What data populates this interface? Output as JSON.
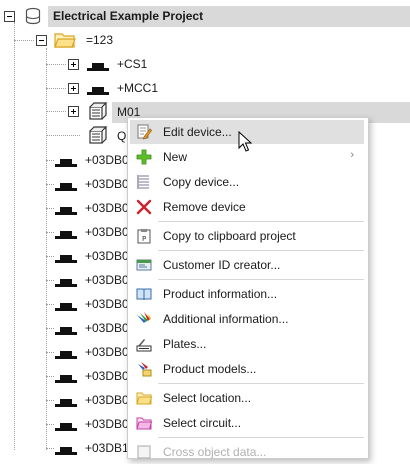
{
  "tree": {
    "root": {
      "label": "Electrical Example Project",
      "icon": "database-icon"
    },
    "group": {
      "label": "=123",
      "icon": "folder-icon"
    },
    "children": [
      {
        "label": "+CS1",
        "icon": "cabinet-icon"
      },
      {
        "label": "+MCC1",
        "icon": "cabinet-icon"
      },
      {
        "label": "M01",
        "icon": "device-icon"
      },
      {
        "label": "Q",
        "icon": "device-icon"
      }
    ],
    "siblings": [
      "+03DB0",
      "+03DB0",
      "+03DB0",
      "+03DB0",
      "+03DB0",
      "+03DB0",
      "+03DB0",
      "+03DB0",
      "+03DB0",
      "+03DB0",
      "+03DB0",
      "+03DB0",
      "+03DB1"
    ]
  },
  "context_menu": {
    "items": [
      {
        "label": "Edit device...",
        "icon": "edit-document-icon",
        "hover": true
      },
      {
        "label": "New",
        "icon": "green-plus-icon",
        "submenu": true
      },
      {
        "label": "Copy device...",
        "icon": "copy-list-icon"
      },
      {
        "label": "Remove device",
        "icon": "red-x-icon"
      },
      {
        "label": "Copy to clipboard project",
        "icon": "clipboard-icon"
      },
      {
        "label": "Customer ID creator...",
        "icon": "id-card-icon"
      },
      {
        "label": "Product information...",
        "icon": "book-icon"
      },
      {
        "label": "Additional information...",
        "icon": "color-pens-icon"
      },
      {
        "label": "Plates...",
        "icon": "plate-icon"
      },
      {
        "label": "Product models...",
        "icon": "models-icon"
      },
      {
        "label": "Select location...",
        "icon": "yellow-folder-icon"
      },
      {
        "label": "Select circuit...",
        "icon": "pink-folder-icon"
      },
      {
        "label": "Cross object data...",
        "icon": "cross-object-icon"
      }
    ],
    "submenu_arrow": "›"
  },
  "colors": {
    "selection": "#d9d9d9",
    "hover": "#e0e0e0",
    "folder": "#f5c542",
    "plus": "#4caf22",
    "remove": "#d0202a"
  }
}
